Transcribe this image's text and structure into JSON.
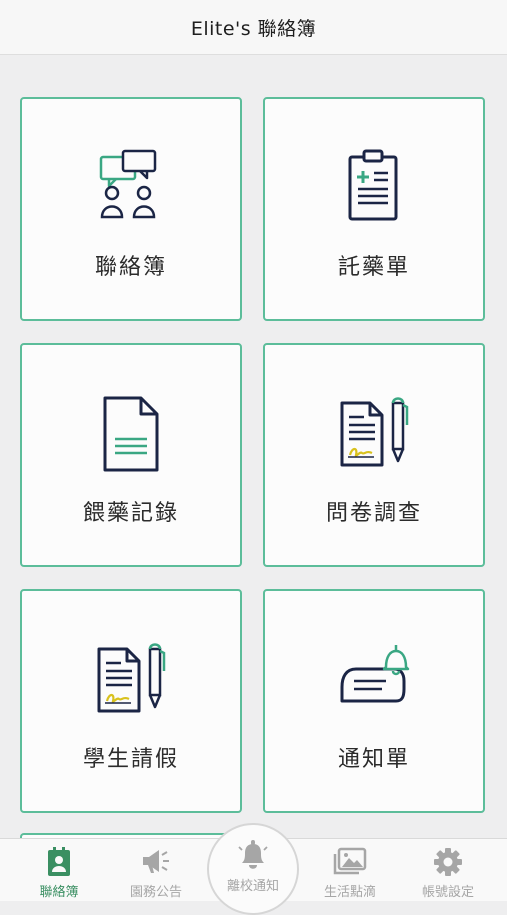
{
  "header": {
    "title": "Elite's 聯絡簿"
  },
  "cards": [
    {
      "label": "聯絡簿",
      "icon": "chat-users-icon"
    },
    {
      "label": "託藥單",
      "icon": "clipboard-medical-icon"
    },
    {
      "label": "餵藥記錄",
      "icon": "document-icon"
    },
    {
      "label": "問卷調查",
      "icon": "document-pen-icon"
    },
    {
      "label": "學生請假",
      "icon": "document-pen-icon"
    },
    {
      "label": "通知單",
      "icon": "notice-bell-icon"
    }
  ],
  "tabbar": {
    "tabs": [
      {
        "label": "聯絡簿",
        "icon": "contact-book-icon",
        "active": true
      },
      {
        "label": "園務公告",
        "icon": "megaphone-icon"
      },
      {
        "label": "離校通知",
        "icon": "bell-icon"
      },
      {
        "label": "生活點滴",
        "icon": "photos-icon"
      },
      {
        "label": "帳號設定",
        "icon": "gear-icon"
      }
    ]
  },
  "colors": {
    "accent": "#5cbd9a",
    "active_tab": "#3a8f62",
    "icon_dark": "#1b2545",
    "highlight": "#d9c21e"
  }
}
